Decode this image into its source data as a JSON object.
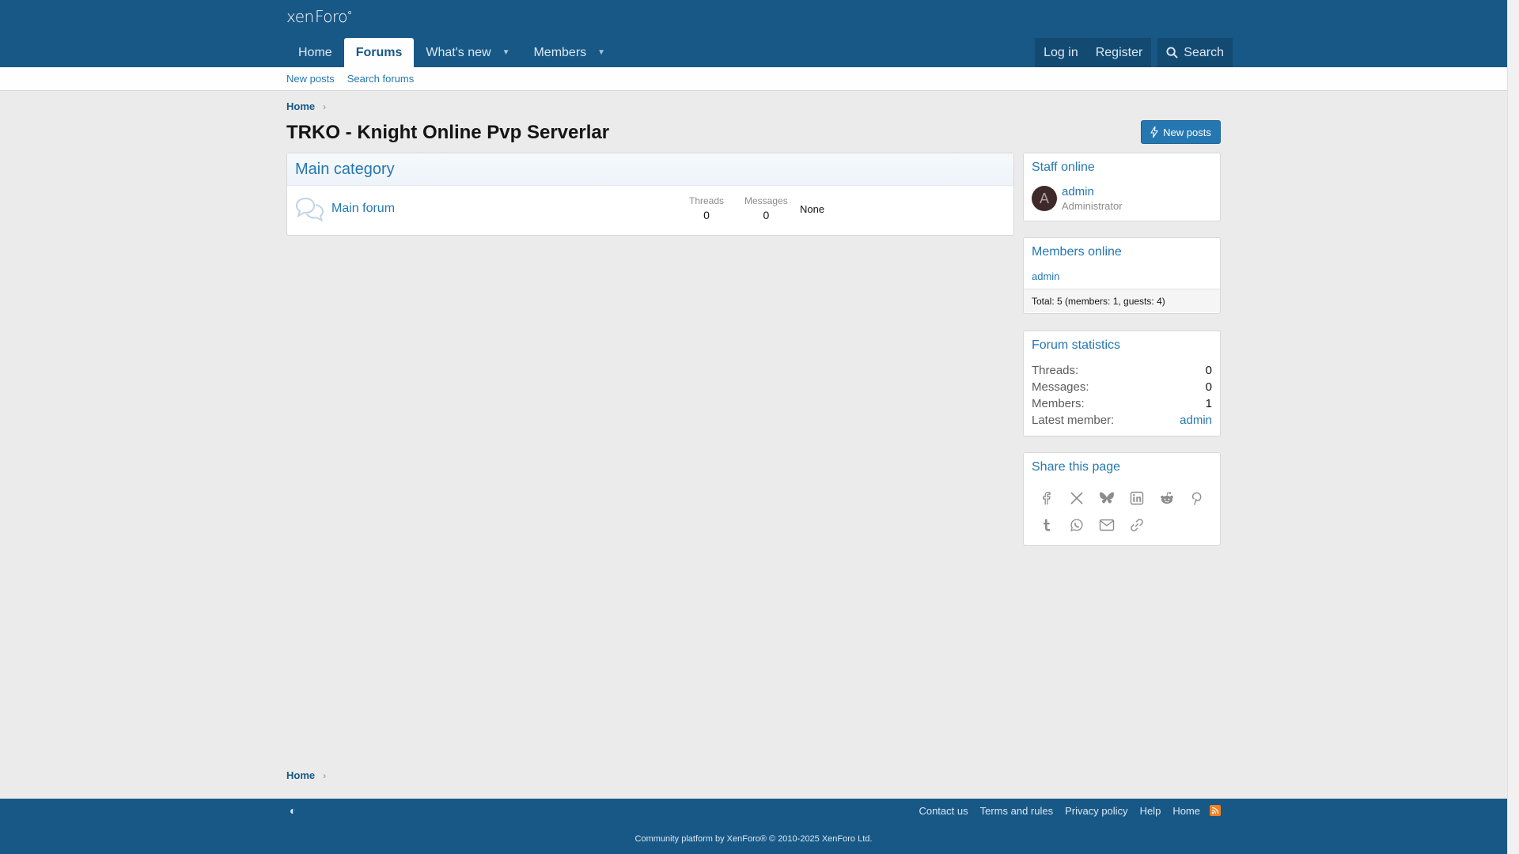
{
  "header": {
    "logo": "xenForo",
    "nav": [
      {
        "label": "Home"
      },
      {
        "label": "Forums"
      },
      {
        "label": "What's new"
      },
      {
        "label": "Members"
      }
    ],
    "login": "Log in",
    "register": "Register",
    "search": "Search"
  },
  "subnav": {
    "new_posts": "New posts",
    "search_forums": "Search forums"
  },
  "breadcrumb": {
    "home": "Home"
  },
  "page": {
    "title": "TRKO - Knight Online Pvp Serverlar",
    "new_posts_button": "New posts"
  },
  "category": {
    "title": "Main category",
    "forums": [
      {
        "title": "Main forum",
        "threads_label": "Threads",
        "threads": "0",
        "messages_label": "Messages",
        "messages": "0",
        "last_post": "None"
      }
    ]
  },
  "sidebar": {
    "staff": {
      "title": "Staff online",
      "avatar_letter": "A",
      "name": "admin",
      "role": "Administrator"
    },
    "members": {
      "title": "Members online",
      "member": "admin",
      "total": "Total: 5 (members: 1, guests: 4)"
    },
    "stats": {
      "title": "Forum statistics",
      "rows": [
        {
          "k": "Threads:",
          "v": "0"
        },
        {
          "k": "Messages:",
          "v": "0"
        },
        {
          "k": "Members:",
          "v": "1"
        },
        {
          "k": "Latest member:",
          "v": "admin"
        }
      ]
    },
    "share": {
      "title": "Share this page",
      "icons": [
        "facebook-icon",
        "x-icon",
        "bluesky-icon",
        "linkedin-icon",
        "reddit-icon",
        "pinterest-icon",
        "tumblr-icon",
        "whatsapp-icon",
        "email-icon",
        "link-icon"
      ]
    }
  },
  "footer": {
    "links": [
      "Contact us",
      "Terms and rules",
      "Privacy policy",
      "Help",
      "Home"
    ],
    "copyright": "Community platform by XenForo® © 2010-2025 XenForo Ltd."
  },
  "colors": {
    "brand": "#185886",
    "link": "#2577b1",
    "background": "#ebebeb"
  }
}
